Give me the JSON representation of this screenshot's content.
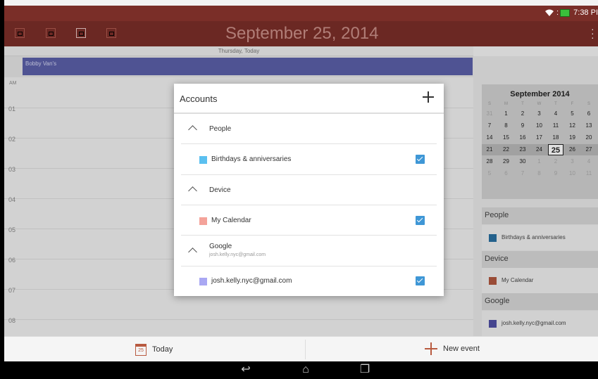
{
  "status": {
    "time": "7:38 PI"
  },
  "header": {
    "title": "September 25, 2014",
    "day_label": "Thursday, Today",
    "view_buttons": [
      "day-view",
      "week-view",
      "month-view",
      "agenda-view"
    ]
  },
  "all_day_event": {
    "title": "Bobby Van's",
    "color": "#5a5fa8"
  },
  "grid": {
    "ampm": "AM",
    "hours": [
      "01",
      "02",
      "03",
      "04",
      "05",
      "06",
      "07",
      "08"
    ]
  },
  "mini_calendar": {
    "title": "September 2014",
    "weekdays": [
      "S",
      "M",
      "T",
      "W",
      "T",
      "F",
      "S"
    ],
    "weeks": [
      [
        "31",
        "1",
        "2",
        "3",
        "4",
        "5",
        "6"
      ],
      [
        "7",
        "8",
        "9",
        "10",
        "11",
        "12",
        "13"
      ],
      [
        "14",
        "15",
        "16",
        "17",
        "18",
        "19",
        "20"
      ],
      [
        "21",
        "22",
        "23",
        "24",
        "25",
        "26",
        "27"
      ],
      [
        "28",
        "29",
        "30",
        "1",
        "2",
        "3",
        "4"
      ],
      [
        "5",
        "6",
        "7",
        "8",
        "9",
        "10",
        "11"
      ]
    ],
    "selected_day": "25"
  },
  "side_accounts": [
    {
      "section": "People",
      "calendar": "Birthdays & anniversaries",
      "color": "#2a6fa0"
    },
    {
      "section": "Device",
      "calendar": "My Calendar",
      "color": "#b0573f"
    },
    {
      "section": "Google",
      "calendar": "josh.kelly.nyc@gmail.com",
      "color": "#4f4fa3"
    }
  ],
  "dialog": {
    "title": "Accounts",
    "groups": [
      {
        "label": "People",
        "sub": "",
        "calendar": "Birthdays & anniversaries",
        "color": "#5bc0f0",
        "checked": true
      },
      {
        "label": "Device",
        "sub": "",
        "calendar": "My Calendar",
        "color": "#f4a39a",
        "checked": true
      },
      {
        "label": "Google",
        "sub": "josh.kelly.nyc@gmail.com",
        "calendar": "josh.kelly.nyc@gmail.com",
        "color": "#a9a8f3",
        "checked": true
      }
    ]
  },
  "bottom": {
    "today_label": "Today",
    "today_icon_day": "25",
    "new_event_label": "New event"
  },
  "colors": {
    "header": "#7a2e28",
    "accent": "#b85a40",
    "checkbox": "#3f97d6"
  }
}
